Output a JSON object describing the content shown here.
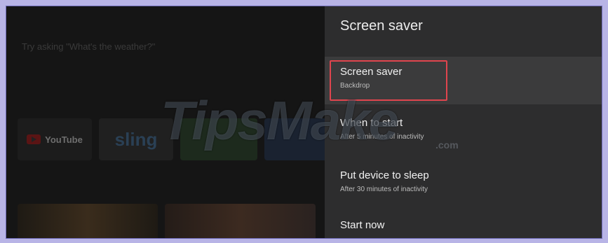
{
  "home": {
    "assistant_hint": "Try asking \"What's the weather?\"",
    "apps": [
      {
        "label": "YouTube"
      },
      {
        "label": "sling"
      }
    ]
  },
  "watermark": {
    "text": "TipsMake",
    "suffix": ".com"
  },
  "panel": {
    "title": "Screen saver",
    "items": [
      {
        "label": "Screen saver",
        "sub": "Backdrop"
      },
      {
        "label": "When to start",
        "sub": "After 5 minutes of inactivity"
      },
      {
        "label": "Put device to sleep",
        "sub": "After 30 minutes of inactivity"
      },
      {
        "label": "Start now"
      }
    ]
  },
  "colors": {
    "highlight_border": "#e0454e",
    "panel_bg": "#2d2d2e",
    "selected_bg": "#3b3b3c"
  }
}
